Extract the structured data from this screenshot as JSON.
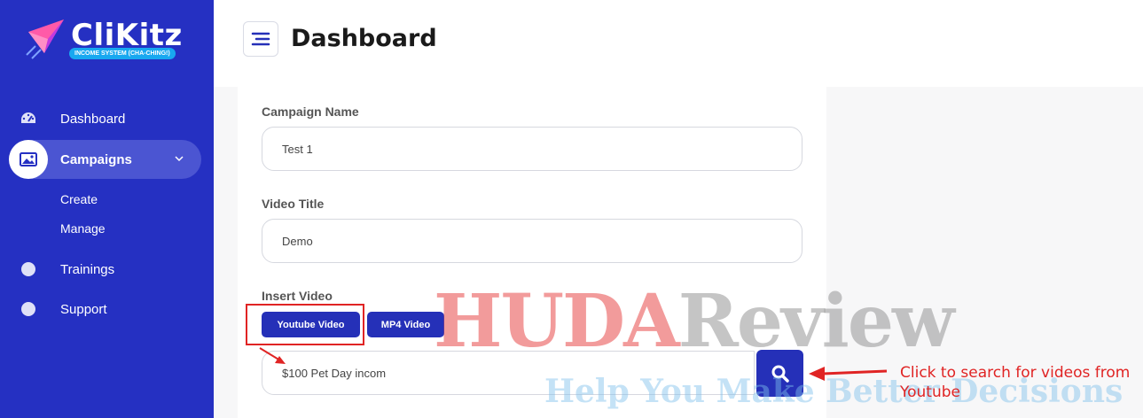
{
  "brand": {
    "name": "CliKitz",
    "tagline": "INCOME SYSTEM (CHA-CHING!)"
  },
  "sidebar": {
    "items": [
      {
        "label": "Dashboard",
        "icon": "dashboard-gauge-icon"
      },
      {
        "label": "Campaigns",
        "icon": "image-icon",
        "active": true
      },
      {
        "label": "Trainings",
        "icon": "dot-icon"
      },
      {
        "label": "Support",
        "icon": "dot-icon"
      }
    ],
    "sub_items": [
      "Create",
      "Manage"
    ]
  },
  "header": {
    "title": "Dashboard"
  },
  "form": {
    "campaign_name": {
      "label": "Campaign Name",
      "value": "Test 1"
    },
    "video_title": {
      "label": "Video Title",
      "value": "Demo"
    },
    "insert_video": {
      "label": "Insert Video",
      "youtube_button": "Youtube Video",
      "mp4_button": "MP4 Video",
      "search_value": "$100 Pet Day incom"
    }
  },
  "watermark": {
    "main_a": "HUDA",
    "main_b": "Review",
    "sub": "Help You Make Better Decisions"
  },
  "annotation": {
    "text": "Click to search for videos from Youtube"
  },
  "colors": {
    "sidebar": "#2530c2",
    "accent": "#2530b8",
    "annotation": "#e02424"
  }
}
